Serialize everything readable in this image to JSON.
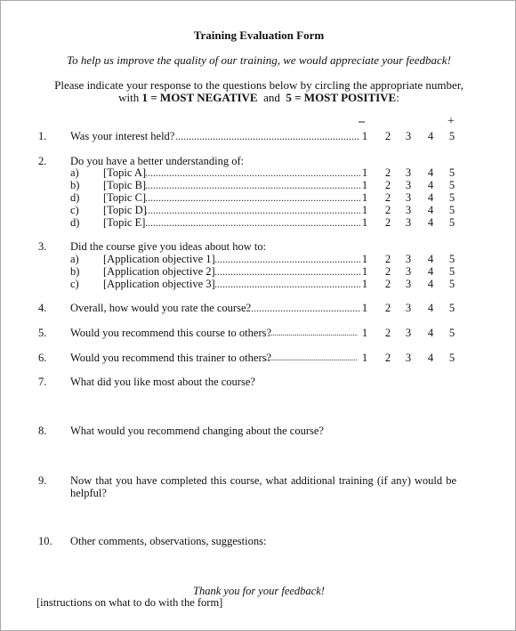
{
  "header": {
    "title": "Training Evaluation Form",
    "subtitle": "To help us improve the quality of our training, we would appreciate your feedback!",
    "instruction_line1": "Please indicate your response to the questions below by circling the appropriate number,",
    "instruction_with": "with",
    "instruction_neg": "1 = MOST NEGATIVE",
    "instruction_and": "and",
    "instruction_pos": "5 = MOST POSITIVE",
    "instruction_end": ":"
  },
  "scale": {
    "negative_symbol": "–",
    "positive_symbol": "+",
    "values": [
      "1",
      "2",
      "3",
      "4",
      "5"
    ]
  },
  "questions": [
    {
      "number": "1.",
      "text": "Was your interest held?"
    },
    {
      "number": "2.",
      "text": "Do you have a better understanding of:",
      "items": [
        {
          "letter": "a)",
          "text": "[Topic A]"
        },
        {
          "letter": "b)",
          "text": "[Topic B]"
        },
        {
          "letter": "d)",
          "text": "[Topic C]"
        },
        {
          "letter": "c)",
          "text": "[Topic D]"
        },
        {
          "letter": "d)",
          "text": "[Topic E]"
        }
      ]
    },
    {
      "number": "3.",
      "text": "Did the course give you ideas about how to:",
      "items": [
        {
          "letter": "a)",
          "text": "[Application objective 1]"
        },
        {
          "letter": "b)",
          "text": "[Application objective 2]"
        },
        {
          "letter": "c)",
          "text": "[Application objective 3]"
        }
      ]
    },
    {
      "number": "4.",
      "text": "Overall, how would you rate the course?"
    },
    {
      "number": "5.",
      "text": "Would you recommend this course to others?"
    },
    {
      "number": "6.",
      "text": "Would you recommend this trainer to others?"
    },
    {
      "number": "7.",
      "text": "What did you like most about the course?"
    },
    {
      "number": "8.",
      "text": "What would you recommend changing about the course?"
    },
    {
      "number": "9.",
      "text": "Now that you have completed this course, what additional training (if any) would be helpful?"
    },
    {
      "number": "10.",
      "text": "Other comments, observations, suggestions:"
    }
  ],
  "footer": {
    "thanks": "Thank you for your feedback!",
    "instructions": "[instructions on what to do with the form]"
  }
}
